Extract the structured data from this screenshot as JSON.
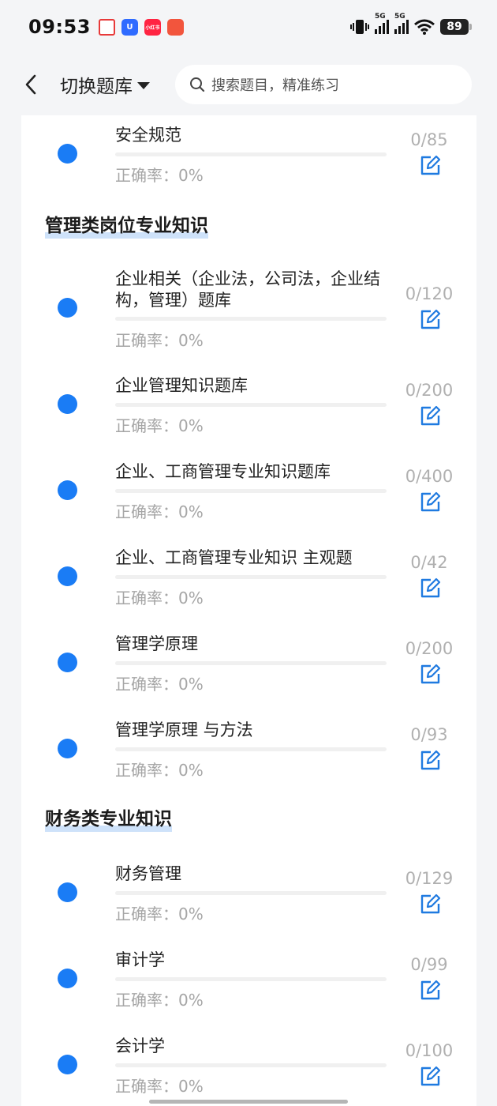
{
  "status_bar": {
    "time": "09:53",
    "battery": "89",
    "network1": "5G",
    "network2": "5G",
    "notif_icons": [
      "app-a-icon",
      "app-u-icon",
      "xiaohongshu-icon",
      "app-red-icon"
    ],
    "notif_labels": [
      "",
      "U",
      "小红书",
      ""
    ]
  },
  "header": {
    "back_icon": "chevron-left-icon",
    "switch_label": "切换题库",
    "search_placeholder": "搜索题目，精准练习"
  },
  "colors": {
    "accent": "#1a7cf5",
    "edit_icon": "#1f7ae0",
    "section_underline": "#5096eb",
    "muted_text": "#a6a6a6"
  },
  "sections": [
    {
      "title": "",
      "items": [
        {
          "title": "安全规范",
          "rate": "正确率：0%",
          "count": "0/85",
          "progress": 0
        }
      ]
    },
    {
      "title": "管理类岗位专业知识",
      "items": [
        {
          "title": "企业相关（企业法，公司法，企业结构，管理）题库",
          "rate": "正确率：0%",
          "count": "0/120",
          "progress": 0
        },
        {
          "title": "企业管理知识题库",
          "rate": "正确率：0%",
          "count": "0/200",
          "progress": 0
        },
        {
          "title": "企业、工商管理专业知识题库",
          "rate": "正确率：0%",
          "count": "0/400",
          "progress": 0
        },
        {
          "title": "企业、工商管理专业知识 主观题",
          "rate": "正确率：0%",
          "count": "0/42",
          "progress": 0
        },
        {
          "title": "管理学原理",
          "rate": "正确率：0%",
          "count": "0/200",
          "progress": 0
        },
        {
          "title": "管理学原理 与方法",
          "rate": "正确率：0%",
          "count": "0/93",
          "progress": 0
        }
      ]
    },
    {
      "title": "财务类专业知识",
      "items": [
        {
          "title": "财务管理",
          "rate": "正确率：0%",
          "count": "0/129",
          "progress": 0
        },
        {
          "title": "审计学",
          "rate": "正确率：0%",
          "count": "0/99",
          "progress": 0
        },
        {
          "title": "会计学",
          "rate": "正确率：0%",
          "count": "0/100",
          "progress": 0
        }
      ]
    }
  ]
}
